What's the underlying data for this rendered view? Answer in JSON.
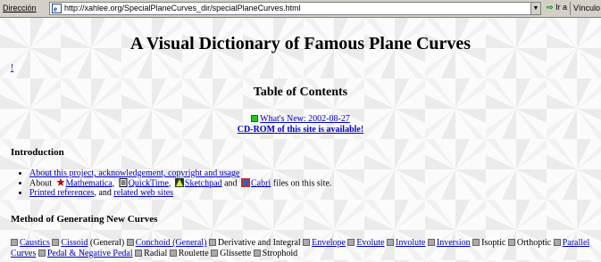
{
  "address_bar": {
    "label": "Dirección",
    "url": "http://xahlee.org/SpecialPlaneCurves_dir/specialPlaneCurves.html",
    "go_label": "Ir a",
    "links_label": "Vínculo"
  },
  "page": {
    "title": "A Visual Dictionary of Famous Plane Curves",
    "bang_link": "!",
    "toc_title": "Table of Contents",
    "whats_new": "What's New: 2002-08-27",
    "cdrom": "CD-ROM of this site is available!"
  },
  "introduction": {
    "heading": "Introduction",
    "item1_link": "About this project, acknowledgement, copyright and usage",
    "item2": {
      "prefix": "About",
      "mathematica": "Mathematica",
      "comma1": ",",
      "quicktime": "QuickTime",
      "comma2": ",",
      "sketchpad": "Sketchpad",
      "and": "and",
      "cabri": "Cabri",
      "suffix": "files on this site."
    },
    "item3": {
      "link1": "Printed references",
      "middle": ", and",
      "link2": "related web sites"
    }
  },
  "methods": {
    "heading": "Method of Generating New Curves",
    "items": [
      {
        "text": "Caustics",
        "link": true,
        "note": ""
      },
      {
        "text": "Cissoid",
        "link": true,
        "note": "(General)"
      },
      {
        "text": "Conchoid (General)",
        "link": true,
        "note": ""
      },
      {
        "text": "Derivative and Integral",
        "link": false,
        "note": ""
      },
      {
        "text": "Envelope",
        "link": true,
        "note": ""
      },
      {
        "text": "Evolute",
        "link": true,
        "note": ""
      },
      {
        "text": "Involute",
        "link": true,
        "note": ""
      },
      {
        "text": "Inversion",
        "link": true,
        "note": ""
      },
      {
        "text": "Isoptic",
        "link": false,
        "note": ""
      },
      {
        "text": "Orthoptic",
        "link": false,
        "note": ""
      },
      {
        "text": "Parallel Curves",
        "link": true,
        "note": ""
      },
      {
        "text": "Pedal & Negative Pedal",
        "link": true,
        "note": ""
      },
      {
        "text": "Radial",
        "link": false,
        "note": ""
      },
      {
        "text": "Roulette",
        "link": false,
        "note": ""
      },
      {
        "text": "Glissette",
        "link": false,
        "note": ""
      },
      {
        "text": "Strophoid",
        "link": false,
        "note": ""
      }
    ]
  },
  "colors": {
    "link": "#0000cc",
    "bullet_square": "#aaaaaa",
    "new_square": "#22c422",
    "chrome": "#d4d0c8"
  }
}
